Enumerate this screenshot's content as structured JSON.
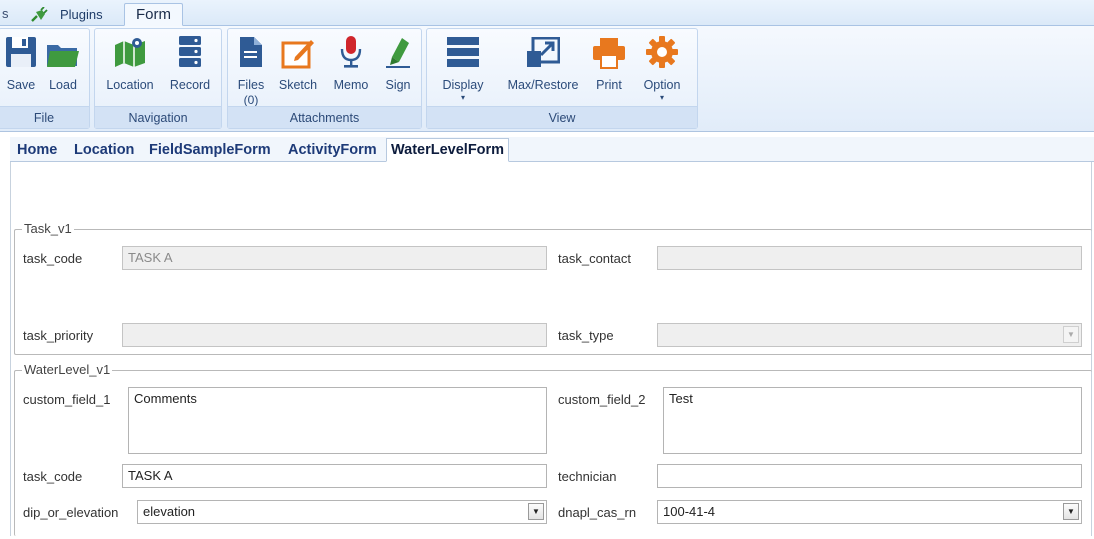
{
  "tabstrip": {
    "stub_label": "s",
    "plugins_label": "Plugins",
    "form_label": "Form"
  },
  "ribbon": {
    "groups": [
      {
        "label": "File",
        "buttons": [
          {
            "label": "Save",
            "icon": "save-icon"
          },
          {
            "label": "Load",
            "icon": "folder-icon"
          }
        ]
      },
      {
        "label": "Navigation",
        "buttons": [
          {
            "label": "Location",
            "icon": "map-icon"
          },
          {
            "label": "Record",
            "icon": "record-icon"
          }
        ]
      },
      {
        "label": "Attachments",
        "buttons": [
          {
            "label": "Files",
            "sub": "(0)",
            "icon": "file-icon"
          },
          {
            "label": "Sketch",
            "icon": "sketch-icon"
          },
          {
            "label": "Memo",
            "icon": "microphone-icon"
          },
          {
            "label": "Sign",
            "icon": "pen-icon"
          }
        ]
      },
      {
        "label": "View",
        "buttons": [
          {
            "label": "Display",
            "icon": "display-icon"
          },
          {
            "label": "Max/Restore",
            "icon": "maximize-icon"
          },
          {
            "label": "Print",
            "icon": "print-icon"
          },
          {
            "label": "Option",
            "icon": "gear-icon"
          }
        ]
      }
    ],
    "dropdown_caret": "▾"
  },
  "page_tabs": [
    "Home",
    "Location",
    "FieldSampleForm",
    "ActivityForm",
    "WaterLevelForm"
  ],
  "task_group": {
    "title": "Task_v1",
    "task_code_label": "task_code",
    "task_code_value": "TASK A",
    "task_contact_label": "task_contact",
    "task_contact_value": "",
    "task_priority_label": "task_priority",
    "task_priority_value": "",
    "task_type_label": "task_type",
    "task_type_value": ""
  },
  "waterlevel_group": {
    "title": "WaterLevel_v1",
    "custom_field_1_label": "custom_field_1",
    "custom_field_1_value": "Comments",
    "custom_field_2_label": "custom_field_2",
    "custom_field_2_value": "Test",
    "task_code_label": "task_code",
    "task_code_value": "TASK A",
    "technician_label": "technician",
    "technician_value": "",
    "dip_label": "dip_or_elevation",
    "dip_value": "elevation",
    "dnapl_label": "dnapl_cas_rn",
    "dnapl_value": "100-41-4"
  },
  "colors": {
    "ribbon_icon_blue": "#2f5b95",
    "accent_orange": "#e8781e",
    "accent_green": "#3f9a3f",
    "accent_red": "#d0262c"
  }
}
